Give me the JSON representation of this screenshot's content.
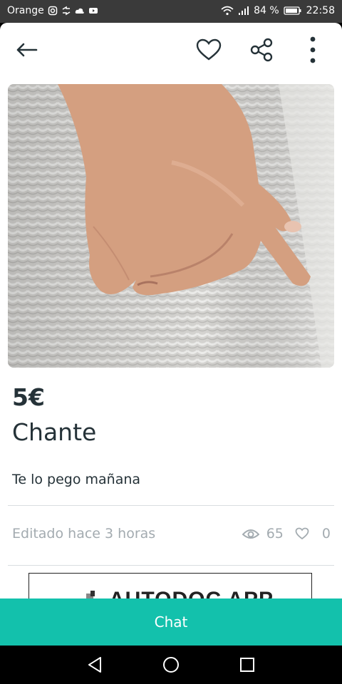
{
  "status_bar": {
    "carrier": "Orange",
    "battery": "84 %",
    "time": "22:58"
  },
  "toolbar": {
    "icons": [
      "back-arrow-icon",
      "heart-icon",
      "share-icon",
      "more-vertical-icon"
    ]
  },
  "listing": {
    "price": "5€",
    "title": "Chante",
    "description": "Te lo pego mañana",
    "edited": "Editado hace 3 horas",
    "views": "65",
    "likes": "0"
  },
  "ad": {
    "text": "AUTODOC APP"
  },
  "actions": {
    "chat_label": "Chat"
  },
  "colors": {
    "accent": "#13c1ac",
    "text_primary": "#253238",
    "text_muted": "#a3abb0"
  }
}
